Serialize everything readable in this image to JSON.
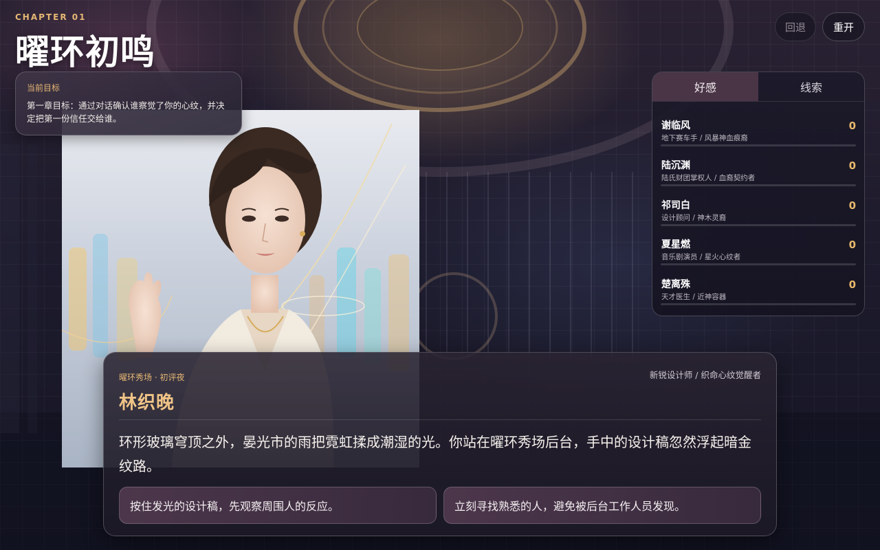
{
  "chapter": {
    "label": "CHAPTER 01",
    "title": "曜环初鸣"
  },
  "controls": {
    "undo_label": "回退",
    "restart_label": "重开"
  },
  "objective": {
    "label": "当前目标",
    "text": "第一章目标：通过对话确认谁察觉了你的心纹，并决定把第一份信任交给谁。"
  },
  "panel": {
    "tabs": [
      {
        "label": "好感",
        "active": true
      },
      {
        "label": "线索",
        "active": false
      }
    ],
    "characters": [
      {
        "name": "谢临风",
        "role": "地下赛车手 / 风暴神血痕裔",
        "affection": 0
      },
      {
        "name": "陆沉渊",
        "role": "陆氏财团掌权人 / 血裔契约者",
        "affection": 0
      },
      {
        "name": "祁司白",
        "role": "设计顾问 / 神木灵裔",
        "affection": 0
      },
      {
        "name": "夏星燃",
        "role": "音乐剧演员 / 星火心纹者",
        "affection": 0
      },
      {
        "name": "楚离殊",
        "role": "天才医生 / 近神容器",
        "affection": 0
      }
    ]
  },
  "dialogue": {
    "scene": "曜环秀场 · 初评夜",
    "speaker": "林织晚",
    "speaker_role": "新锐设计师 / 织命心纹觉醒者",
    "text": "环形玻璃穹顶之外，晏光市的雨把霓虹揉成潮湿的光。你站在曜环秀场后台，手中的设计稿忽然浮起暗金纹路。",
    "choices": [
      "按住发光的设计稿，先观察周围人的反应。",
      "立刻寻找熟悉的人，避免被后台工作人员发现。"
    ]
  },
  "colors": {
    "accent_gold": "#e5b773",
    "speaker_gold": "#f0c487",
    "tab_active": "#4a3547"
  }
}
